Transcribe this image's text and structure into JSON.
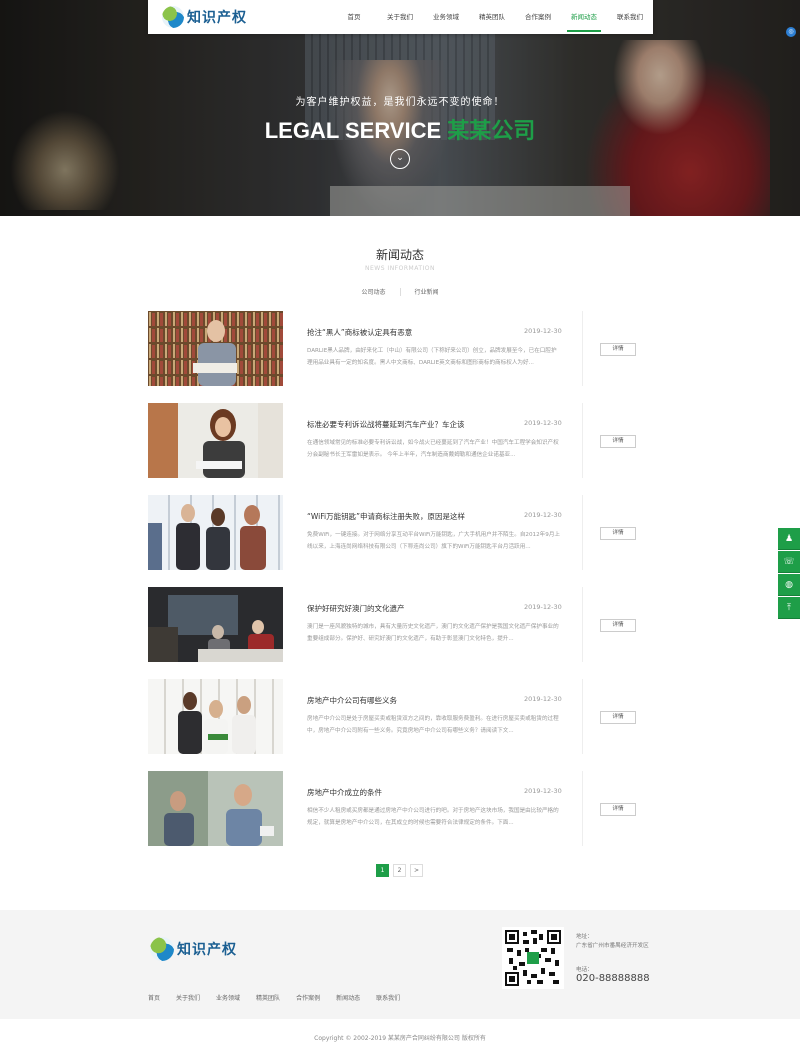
{
  "header": {
    "logo_text": "知识产权",
    "nav": [
      "首页",
      "关于我们",
      "业务领域",
      "精英团队",
      "合作案例",
      "新闻动态",
      "联系我们"
    ],
    "active_nav": "新闻动态"
  },
  "hero": {
    "subtitle": "为客户维护权益，是我们永远不变的使命！",
    "title_white": "LEGAL SERVICE",
    "title_green": "某某公司"
  },
  "news": {
    "title": "新闻动态",
    "subtitle": "NEWS INFORMATION",
    "tabs": [
      "公司动态",
      "行业新闻"
    ],
    "detail_label": "详情",
    "items": [
      {
        "title": "抢注“黑人”商标被认定具有恶意",
        "date": "2019-12-30",
        "desc": "DARLIE黑人品牌，由好来化工（中山）有限公司（下称好来公司）创立，品牌发展至今，已在口腔护理用品业具有一定的知名度。黑人中文商标、DARLIE英文商标和图形商标的商标权人为好..."
      },
      {
        "title": "标准必要专利诉讼战将蔓延到汽车产业？车企该",
        "date": "2019-12-30",
        "desc": "在通信领域常见的标准必要专利诉讼战，如今战火已经蔓延到了汽车产业！中国汽车工程学会知识产权分会副秘书长王军雷如是表示。 今年上半年，汽车制造商戴姆勒和通信企业诺基亚..."
      },
      {
        "title": "“WiFi万能钥匙”申请商标注册失败，原因是这样",
        "date": "2019-12-30",
        "desc": "免费WiFi，一键连接。对于网络分享互动平台WiFi万能钥匙，广大手机用户并不陌生。自2012年9月上线以来，上海连尚网络科技有限公司（下称连尚公司）旗下的WiFi万能钥匙平台月活跃用..."
      },
      {
        "title": "保护好研究好澳门的文化遗产",
        "date": "2019-12-30",
        "desc": "澳门是一座风貌独特的城市，具有大量历史文化遗产，澳门的文化遗产保护是我国文化遗产保护事业的重要组成部分。保护好、研究好澳门的文化遗产，有助于彰显澳门文化特色，提升..."
      },
      {
        "title": "房地产中介公司有哪些义务",
        "date": "2019-12-30",
        "desc": "房地产中介公司是处于房屋买卖或租赁双方之间的，靠收取服务费盈利。在进行房屋买卖或租赁的过程中，房地产中介公司附有一些义务。究竟房地产中介公司有哪些义务？请阅读下文..."
      },
      {
        "title": "房地产中介成立的条件",
        "date": "2019-12-30",
        "desc": "相信不少人租房或买房都是通过房地产中介公司进行的吧。对于房地产这块市场，我国是由比较严格的规定，就算是房地产中介公司，在其成立的时候也需要符合法律规定的条件。下面..."
      }
    ],
    "pages": [
      "1",
      "2",
      ">"
    ],
    "current_page": "1"
  },
  "side": [
    "qq-icon",
    "phone-icon",
    "wechat-icon",
    "back-to-top-icon"
  ],
  "footer": {
    "logo_text": "知识产权",
    "nav": [
      "首页",
      "关于我们",
      "业务领域",
      "精英团队",
      "合作案例",
      "新闻动态",
      "联系我们"
    ],
    "address_label": "地址：",
    "address": "广东省广州市番禺经济开发区",
    "tel_label": "电话：",
    "tel": "020-88888888",
    "copyright": "Copyright © 2002-2019 某某房产合同纠纷有限公司 版权所有"
  },
  "colors": {
    "accent": "#1e9e48",
    "footer_bg": "#f4f4f4"
  }
}
